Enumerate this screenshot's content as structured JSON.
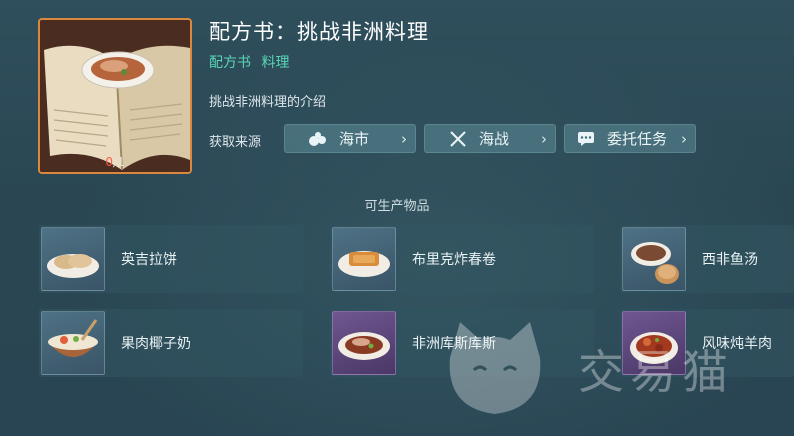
{
  "recipe": {
    "title": "配方书：挑战非洲料理",
    "tags": [
      "配方书",
      "料理"
    ],
    "description": "挑战非洲料理的介绍",
    "owned": "0",
    "total": "/1"
  },
  "sources": {
    "label": "获取来源",
    "items": [
      {
        "label": "海市",
        "icon": "market-icon"
      },
      {
        "label": "海战",
        "icon": "crossed-swords-icon"
      },
      {
        "label": "委托任务",
        "icon": "chat-bubble-icon"
      }
    ]
  },
  "products": {
    "title": "可生产物品",
    "items": [
      {
        "name": "英吉拉饼"
      },
      {
        "name": "布里克炸春卷"
      },
      {
        "name": "西非鱼汤"
      },
      {
        "name": "果肉椰子奶"
      },
      {
        "name": "非洲库斯库斯"
      },
      {
        "name": "风味炖羊肉"
      }
    ]
  },
  "watermark": {
    "text": "交易猫"
  },
  "colors": {
    "accent_green": "#59d6b5",
    "frame_orange": "#d9883e",
    "count_red": "#ff5a4a"
  }
}
